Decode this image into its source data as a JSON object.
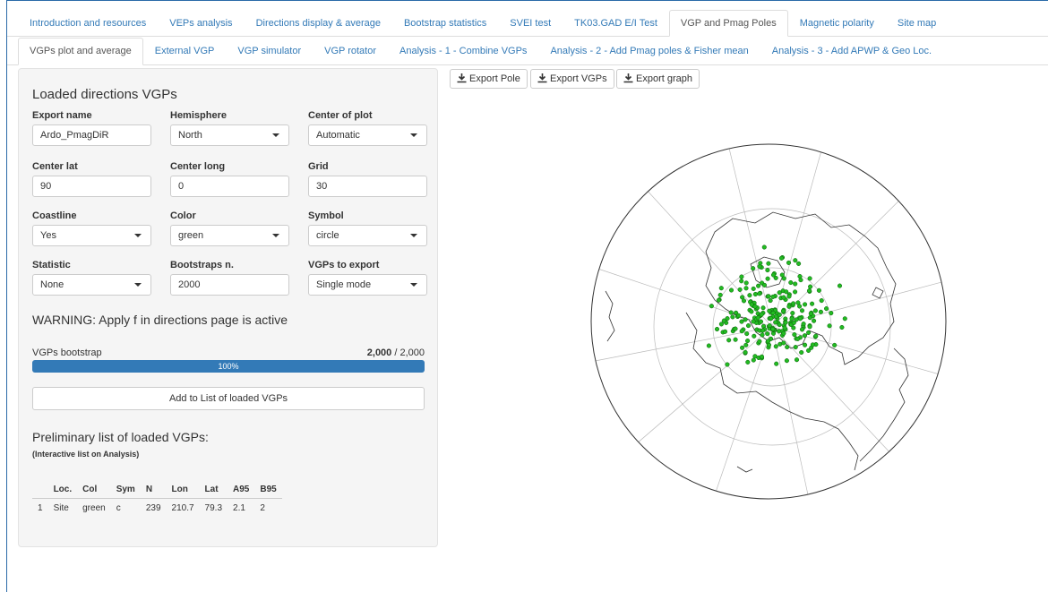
{
  "nav": {
    "main_tabs": [
      "Introduction and resources",
      "VEPs analysis",
      "Directions display & average",
      "Bootstrap statistics",
      "SVEI test",
      "TK03.GAD E/I Test",
      "VGP and Pmag Poles",
      "Magnetic polarity",
      "Site map"
    ],
    "main_active": "VGP and Pmag Poles",
    "sub_tabs": [
      "VGPs plot and average",
      "External VGP",
      "VGP simulator",
      "VGP rotator",
      "Analysis - 1 - Combine VGPs",
      "Analysis - 2 - Add Pmag poles & Fisher mean",
      "Analysis - 3 - Add APWP & Geo Loc."
    ],
    "sub_active": "VGPs plot and average"
  },
  "panel": {
    "title": "Loaded directions VGPs",
    "export_name": {
      "label": "Export name",
      "value": "Ardo_PmagDiR"
    },
    "hemisphere": {
      "label": "Hemisphere",
      "value": "North"
    },
    "center_of_plot": {
      "label": "Center of plot",
      "value": "Automatic"
    },
    "center_lat": {
      "label": "Center lat",
      "value": "90"
    },
    "center_long": {
      "label": "Center long",
      "value": "0"
    },
    "grid": {
      "label": "Grid",
      "value": "30"
    },
    "coastline": {
      "label": "Coastline",
      "value": "Yes"
    },
    "color": {
      "label": "Color",
      "value": "green"
    },
    "symbol": {
      "label": "Symbol",
      "value": "circle"
    },
    "statistic": {
      "label": "Statistic",
      "value": "None"
    },
    "bootstraps": {
      "label": "Bootstraps n.",
      "value": "2000"
    },
    "vgps_to_export": {
      "label": "VGPs to export",
      "value": "Single mode"
    },
    "warning": "WARNING: Apply f in directions page is active",
    "progress": {
      "label": "VGPs bootstrap",
      "done": "2,000",
      "total": "/ 2,000",
      "percent_text": "100%",
      "fraction": 1.0
    },
    "add_button": "Add to List of loaded VGPs",
    "list_title": "Preliminary list of loaded VGPs:",
    "list_subtitle": "(Interactive list on Analysis)",
    "table": {
      "headers": [
        "",
        "Loc.",
        "Col",
        "Sym",
        "N",
        "Lon",
        "Lat",
        "A95",
        "B95"
      ],
      "rows": [
        [
          "1",
          "Site",
          "green",
          "c",
          "239",
          "210.7",
          "79.3",
          "2.1",
          "2"
        ]
      ]
    }
  },
  "export_buttons": [
    "Export Pole",
    "Export VGPs",
    "Export graph"
  ],
  "plot": {
    "point_color": "#22bb22",
    "point_stroke": "#0a5a0a"
  }
}
